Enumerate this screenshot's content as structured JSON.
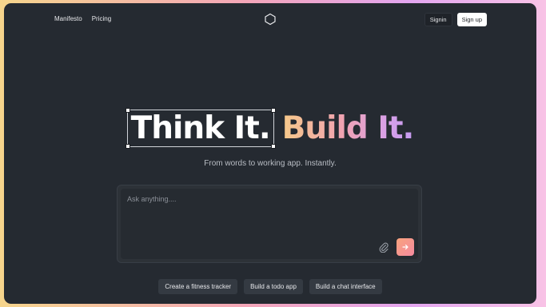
{
  "colors": {
    "frame_bg": "#252a31",
    "accent_gradient": [
      "#f6c98a",
      "#f0a3b0",
      "#d8a0e8",
      "#c59bf0"
    ],
    "send_button": "#f58a9f"
  },
  "header": {
    "nav": [
      {
        "label": "Manifesto"
      },
      {
        "label": "Pricing"
      }
    ],
    "logo_icon": "hexagon-icon",
    "signin_label": "Signin",
    "signup_label": "Sign up"
  },
  "hero": {
    "headline_part1": "Think It.",
    "headline_part2": "Build It.",
    "tagline": "From words to working app. Instantly."
  },
  "prompt": {
    "placeholder": "Ask anything....",
    "value": "",
    "attach_icon": "paperclip-icon",
    "send_icon": "arrow-right-icon"
  },
  "suggestions": [
    {
      "label": "Create a fitness tracker"
    },
    {
      "label": "Build a todo app"
    },
    {
      "label": "Build a chat interface"
    }
  ]
}
